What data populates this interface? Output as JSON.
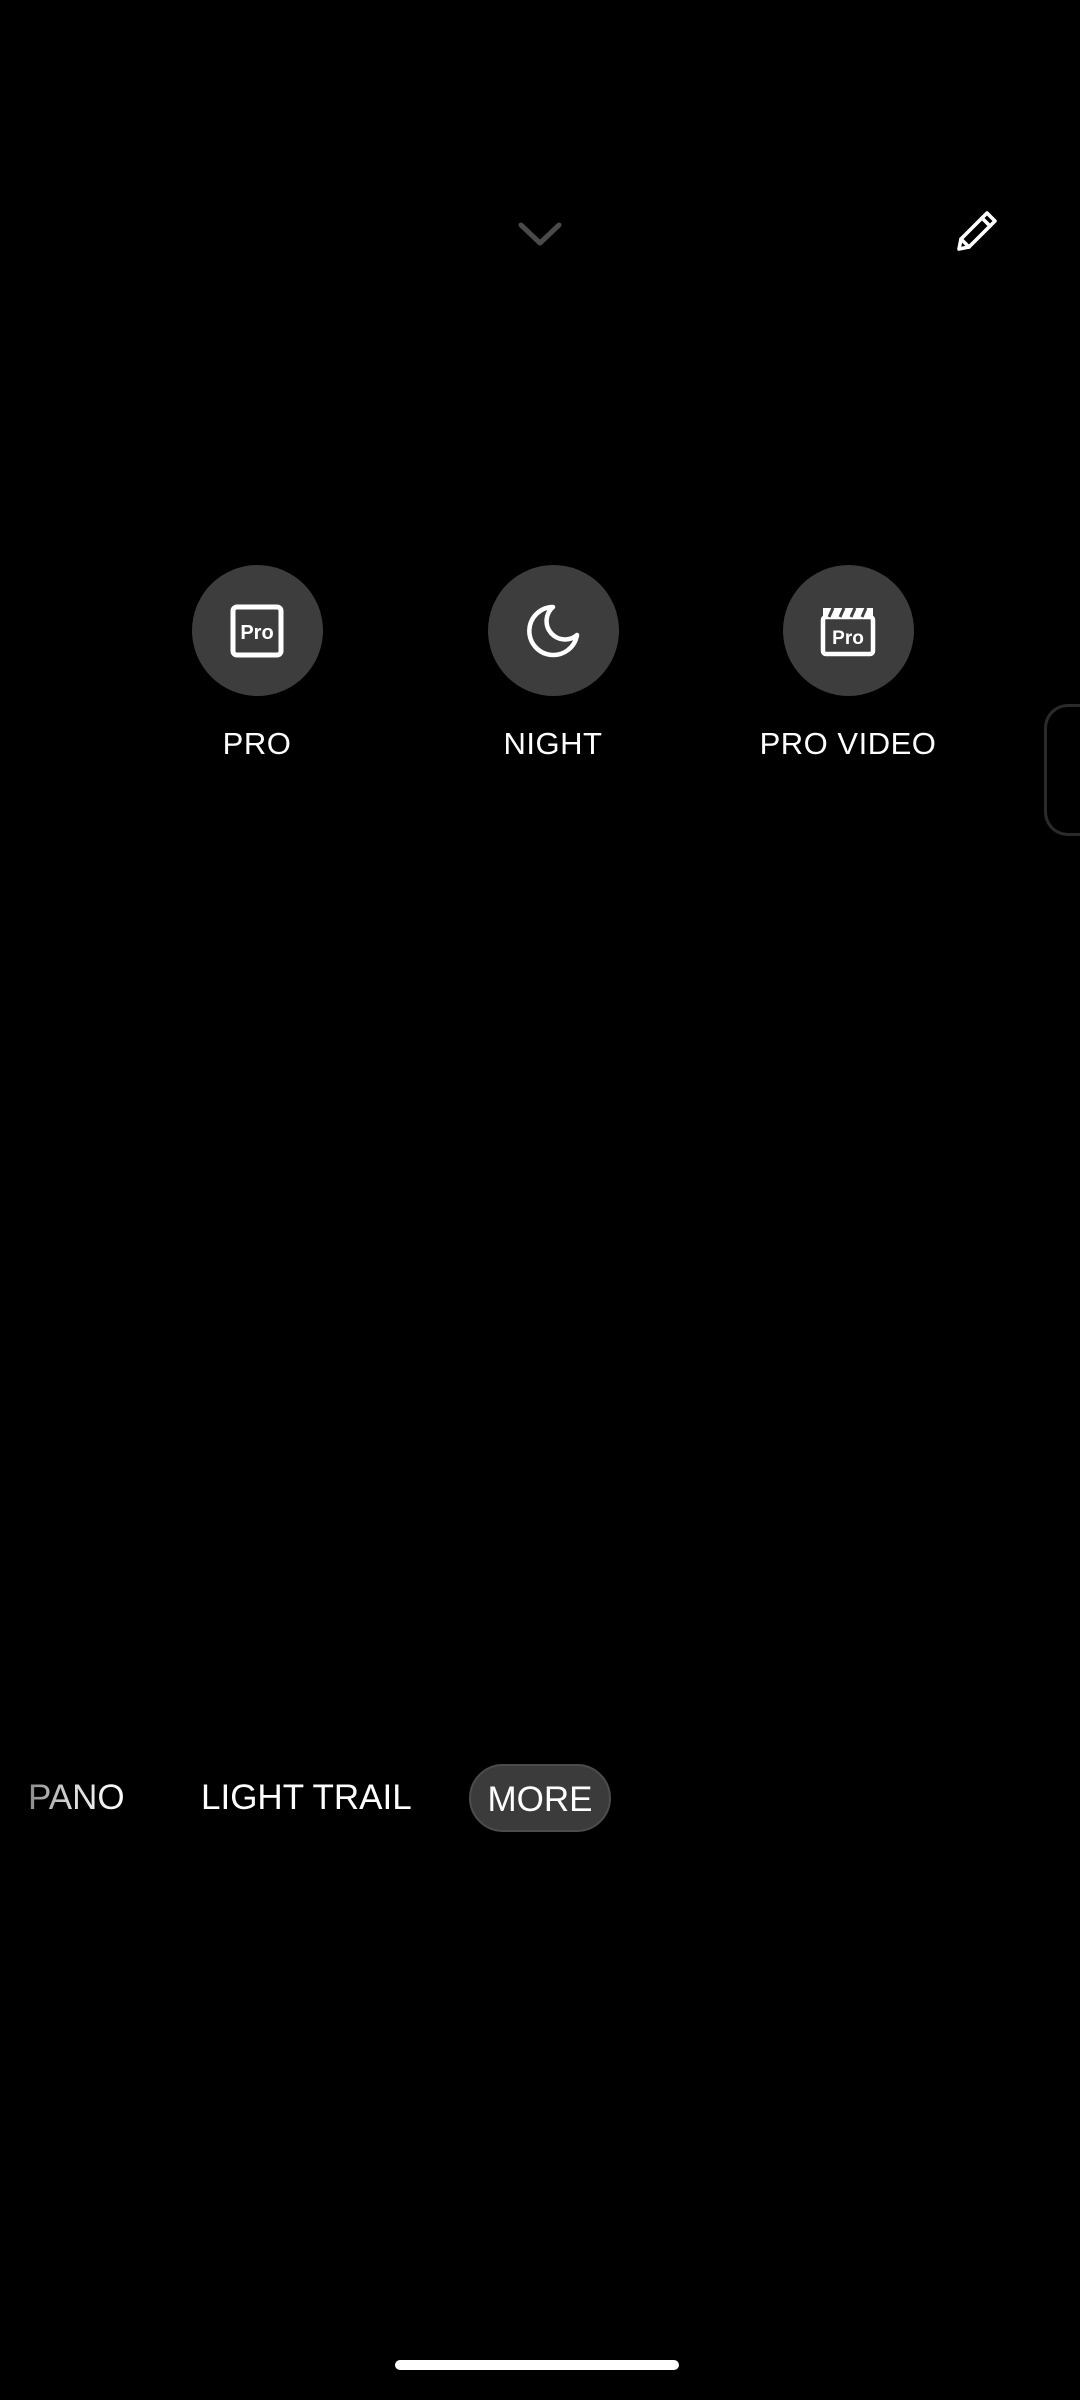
{
  "top_controls": {
    "collapse_icon": "chevron-down-icon",
    "edit_icon": "pencil-icon"
  },
  "modes": [
    {
      "label": "PRO",
      "icon": "pro-icon"
    },
    {
      "label": "NIGHT",
      "icon": "moon-icon"
    },
    {
      "label": "PRO VIDEO",
      "icon": "pro-video-icon"
    }
  ],
  "mode_strip": {
    "items": [
      "PANO",
      "LIGHT TRAIL",
      "MORE"
    ],
    "selected": "MORE"
  },
  "colors": {
    "background": "#000000",
    "circle": "#3d3d3d",
    "pill": "#3b3b3b",
    "chevron": "#4a4a4a"
  }
}
